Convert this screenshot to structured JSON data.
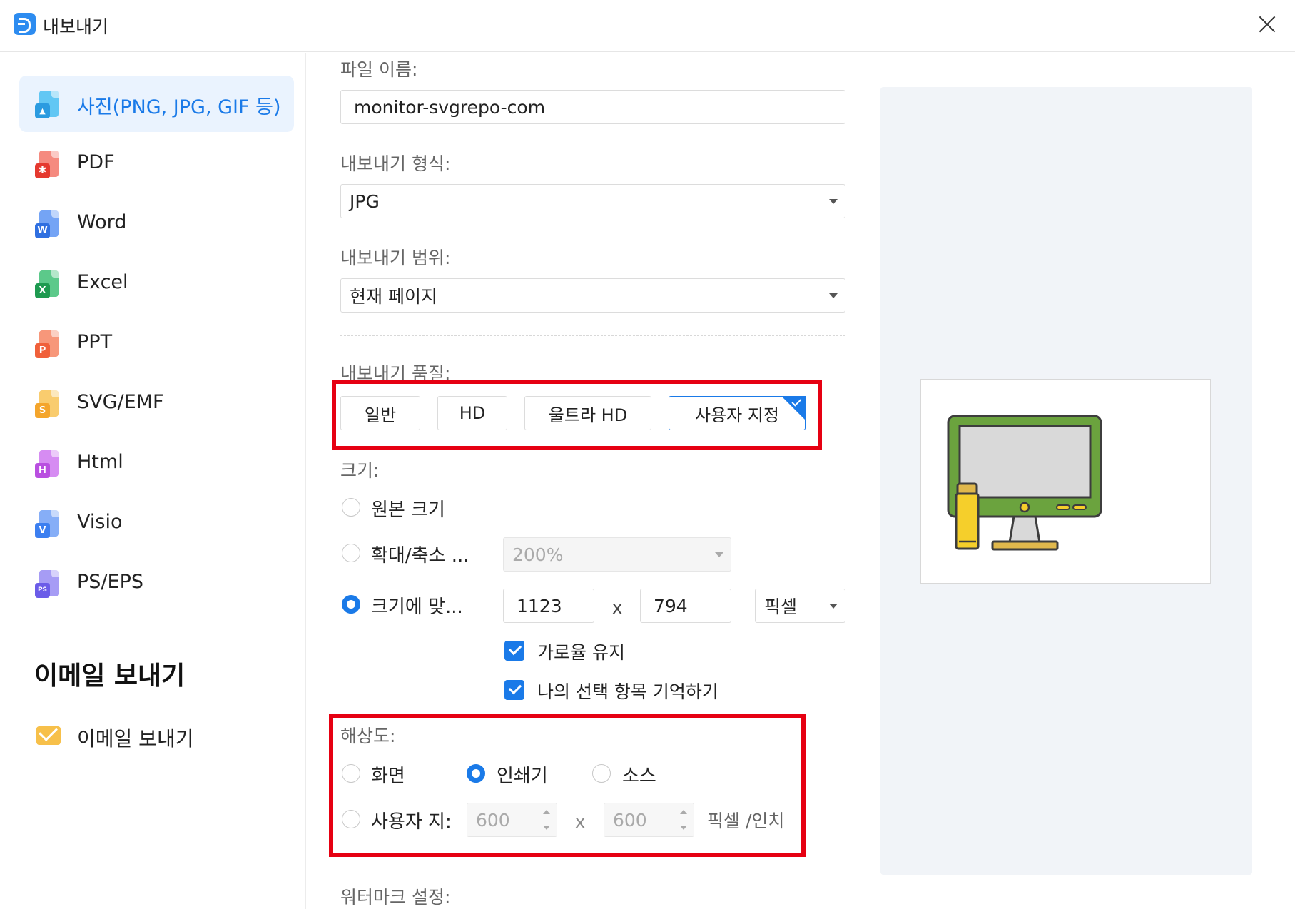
{
  "window": {
    "title": "내보내기",
    "logo": "app-logo-icon",
    "close": "close-icon"
  },
  "sidebar": {
    "items": [
      {
        "label": "사진(PNG, JPG, GIF 등)",
        "icon": "image-file-icon",
        "active": true
      },
      {
        "label": "PDF",
        "icon": "pdf-file-icon",
        "badge": "",
        "color": "#ef4b3f"
      },
      {
        "label": "Word",
        "icon": "word-file-icon",
        "badge": "W",
        "color": "#2f6fe0"
      },
      {
        "label": "Excel",
        "icon": "excel-file-icon",
        "badge": "X",
        "color": "#1e9a50"
      },
      {
        "label": "PPT",
        "icon": "ppt-file-icon",
        "badge": "P",
        "color": "#f0603a"
      },
      {
        "label": "SVG/EMF",
        "icon": "svg-file-icon",
        "badge": "S",
        "color": "#f4a52c"
      },
      {
        "label": "Html",
        "icon": "html-file-icon",
        "badge": "H",
        "color": "#b94fe0"
      },
      {
        "label": "Visio",
        "icon": "visio-file-icon",
        "badge": "V",
        "color": "#3c7ff0"
      },
      {
        "label": "PS/EPS",
        "icon": "ps-file-icon",
        "badge": "PS",
        "color": "#6b5ce8"
      }
    ],
    "email_heading": "이메일 보내기",
    "email_item": {
      "label": "이메일 보내기",
      "icon": "envelope-icon"
    }
  },
  "form": {
    "filename_label": "파일 이름:",
    "filename_value": "monitor-svgrepo-com",
    "format_label": "내보내기 형식:",
    "format_value": "JPG",
    "range_label": "내보내기 범위:",
    "range_value": "현재 페이지",
    "quality_label": "내보내기 품질:",
    "quality_options": [
      "일반",
      "HD",
      "울트라 HD",
      "사용자 지정"
    ],
    "quality_selected": 3,
    "size_label": "크기:",
    "size_original": "원본 크기",
    "size_scale": "확대/축소 ...",
    "size_scale_value": "200%",
    "size_fit": "크기에 맞...",
    "width": "1123",
    "height": "794",
    "x": "x",
    "unit": "픽셀",
    "keep_ratio": "가로율 유지",
    "remember": "나의 선택 항목 기억하기",
    "resolution_label": "해상도:",
    "res_screen": "화면",
    "res_printer": "인쇄기",
    "res_source": "소스",
    "res_custom": "사용자 지:",
    "res_x": "600",
    "res_y": "600",
    "res_unit": "픽셀 /인치",
    "watermark_label": "워터마크 설정:"
  },
  "preview": {
    "icon": "monitor-icon",
    "colors": {
      "bezel": "#6ba33e",
      "screen": "#d9d9d9",
      "stand": "#e0b84c",
      "accent": "#f5cf2b",
      "outline": "#3d3d3d"
    }
  },
  "colors": {
    "accent": "#1a7ae8",
    "highlight": "#e60012"
  }
}
